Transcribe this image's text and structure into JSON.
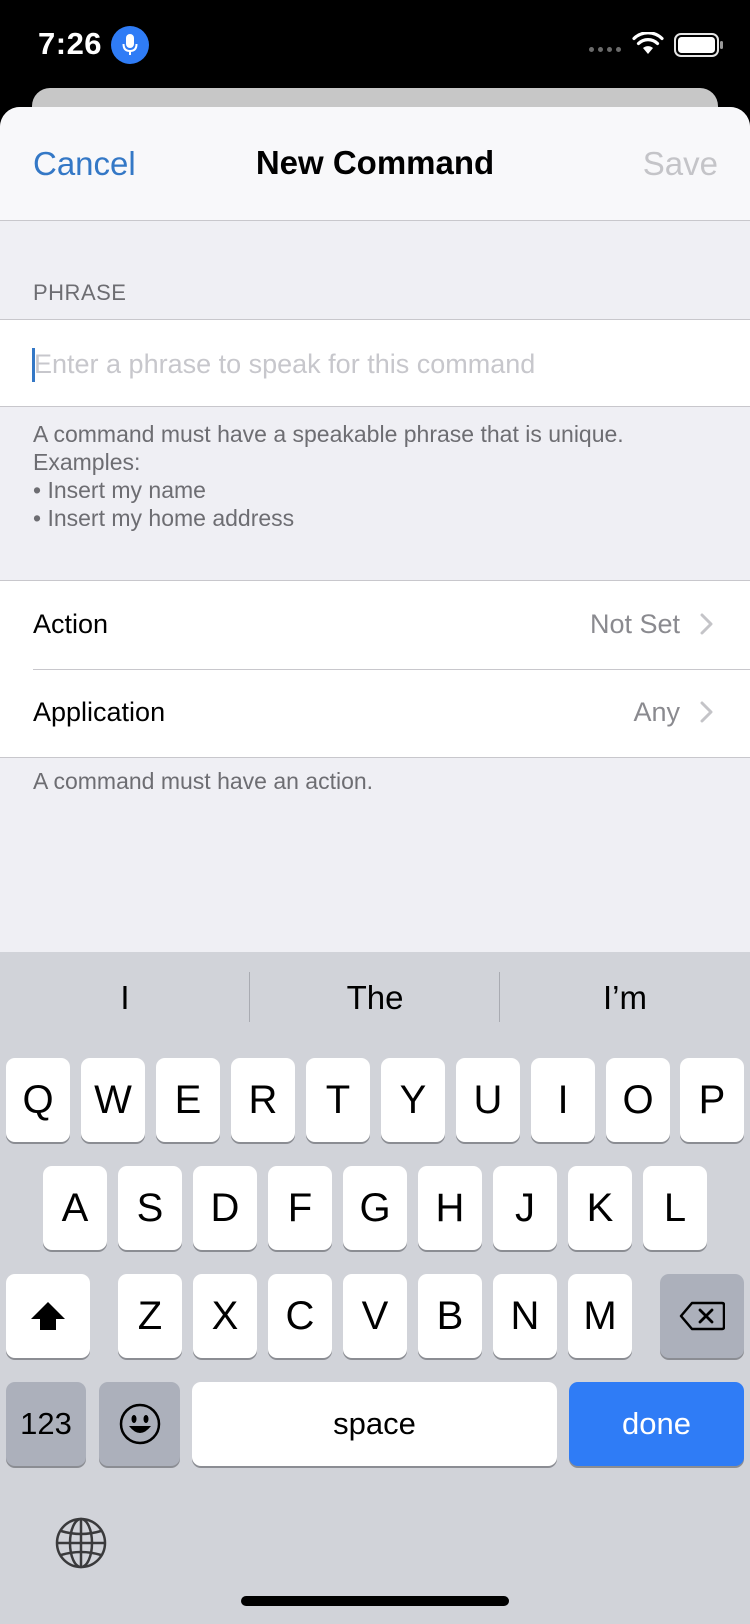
{
  "status_bar": {
    "time": "7:26"
  },
  "nav": {
    "cancel_label": "Cancel",
    "title": "New Command",
    "save_label": "Save"
  },
  "phrase_section": {
    "header": "PHRASE",
    "input_value": "",
    "input_placeholder": "Enter a phrase to speak for this command",
    "footer_lines": [
      "A command must have a speakable phrase that is unique.",
      "Examples:",
      "• Insert my name",
      "• Insert my home address"
    ]
  },
  "settings": {
    "rows": [
      {
        "label": "Action",
        "value": "Not Set"
      },
      {
        "label": "Application",
        "value": "Any"
      }
    ],
    "footer": "A command must have an action."
  },
  "keyboard": {
    "predictions": [
      "I",
      "The",
      "I’m"
    ],
    "row1": [
      "Q",
      "W",
      "E",
      "R",
      "T",
      "Y",
      "U",
      "I",
      "O",
      "P"
    ],
    "row2": [
      "A",
      "S",
      "D",
      "F",
      "G",
      "H",
      "J",
      "K",
      "L"
    ],
    "row3": [
      "Z",
      "X",
      "C",
      "V",
      "B",
      "N",
      "M"
    ],
    "numbers_label": "123",
    "space_label": "space",
    "done_label": "done"
  },
  "colors": {
    "accent": "#3478c6",
    "done_key": "#2f7cf6"
  },
  "icons": [
    "microphone-icon",
    "signal-icon",
    "wifi-icon",
    "battery-icon",
    "chevron-right-icon",
    "shift-icon",
    "backspace-icon",
    "emoji-icon",
    "globe-icon"
  ]
}
